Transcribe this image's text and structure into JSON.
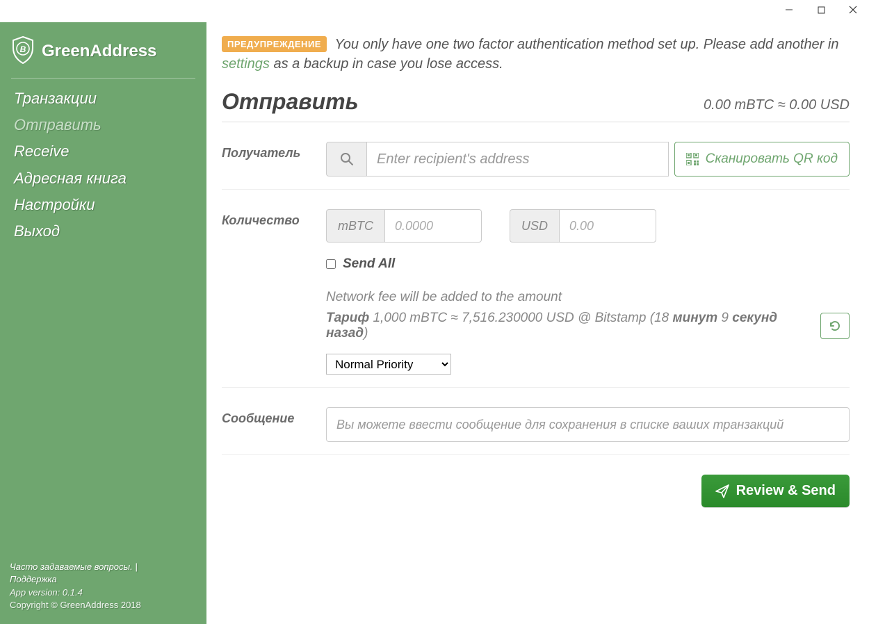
{
  "window": {
    "minimize": "—",
    "maximize": "▢",
    "close": "✕"
  },
  "sidebar": {
    "brand": "GreenAddress",
    "items": [
      {
        "label": "Транзакции",
        "active": false
      },
      {
        "label": "Отправить",
        "active": true
      },
      {
        "label": "Receive",
        "active": false
      },
      {
        "label": "Адресная книга",
        "active": false
      },
      {
        "label": "Настройки",
        "active": false
      },
      {
        "label": "Выход",
        "active": false
      }
    ],
    "faq": "Часто задаваемые вопросы.",
    "sep": " | ",
    "support": "Поддержка",
    "version_label": "App version: 0.1.4",
    "copyright": "Copyright © GreenAddress 2018"
  },
  "warning": {
    "badge": "ПРЕДУПРЕЖДЕНИЕ",
    "text_before": " You only have one two factor authentication method set up. Please add another in ",
    "settings_link": "settings",
    "text_after": " as a backup in case you lose access."
  },
  "header": {
    "title": "Отправить",
    "balance": "0.00 mBTC ≈ 0.00 USD"
  },
  "recipient": {
    "label": "Получатель",
    "placeholder": "Enter recipient's address",
    "scan_qr": "Сканировать QR код"
  },
  "amount": {
    "label": "Количество",
    "unit1": "mBTC",
    "placeholder1": "0.0000",
    "unit2": "USD",
    "placeholder2": "0.00",
    "send_all": "Send All",
    "fee_note": "Network fee will be added to the amount",
    "rate_bold_label": "Тариф",
    "rate_value": " 1,000 mBTC ≈ 7,516.230000 USD @ Bitstamp (18 ",
    "rate_minutes_bold": "минут",
    "rate_mid": " 9 ",
    "rate_seconds_bold": "секунд назад",
    "rate_close": ")",
    "priority_selected": "Normal Priority"
  },
  "message": {
    "label": "Сообщение",
    "placeholder": "Вы можете ввести сообщение для сохранения в списке ваших транзакций"
  },
  "action": {
    "review_send": "Review & Send"
  }
}
